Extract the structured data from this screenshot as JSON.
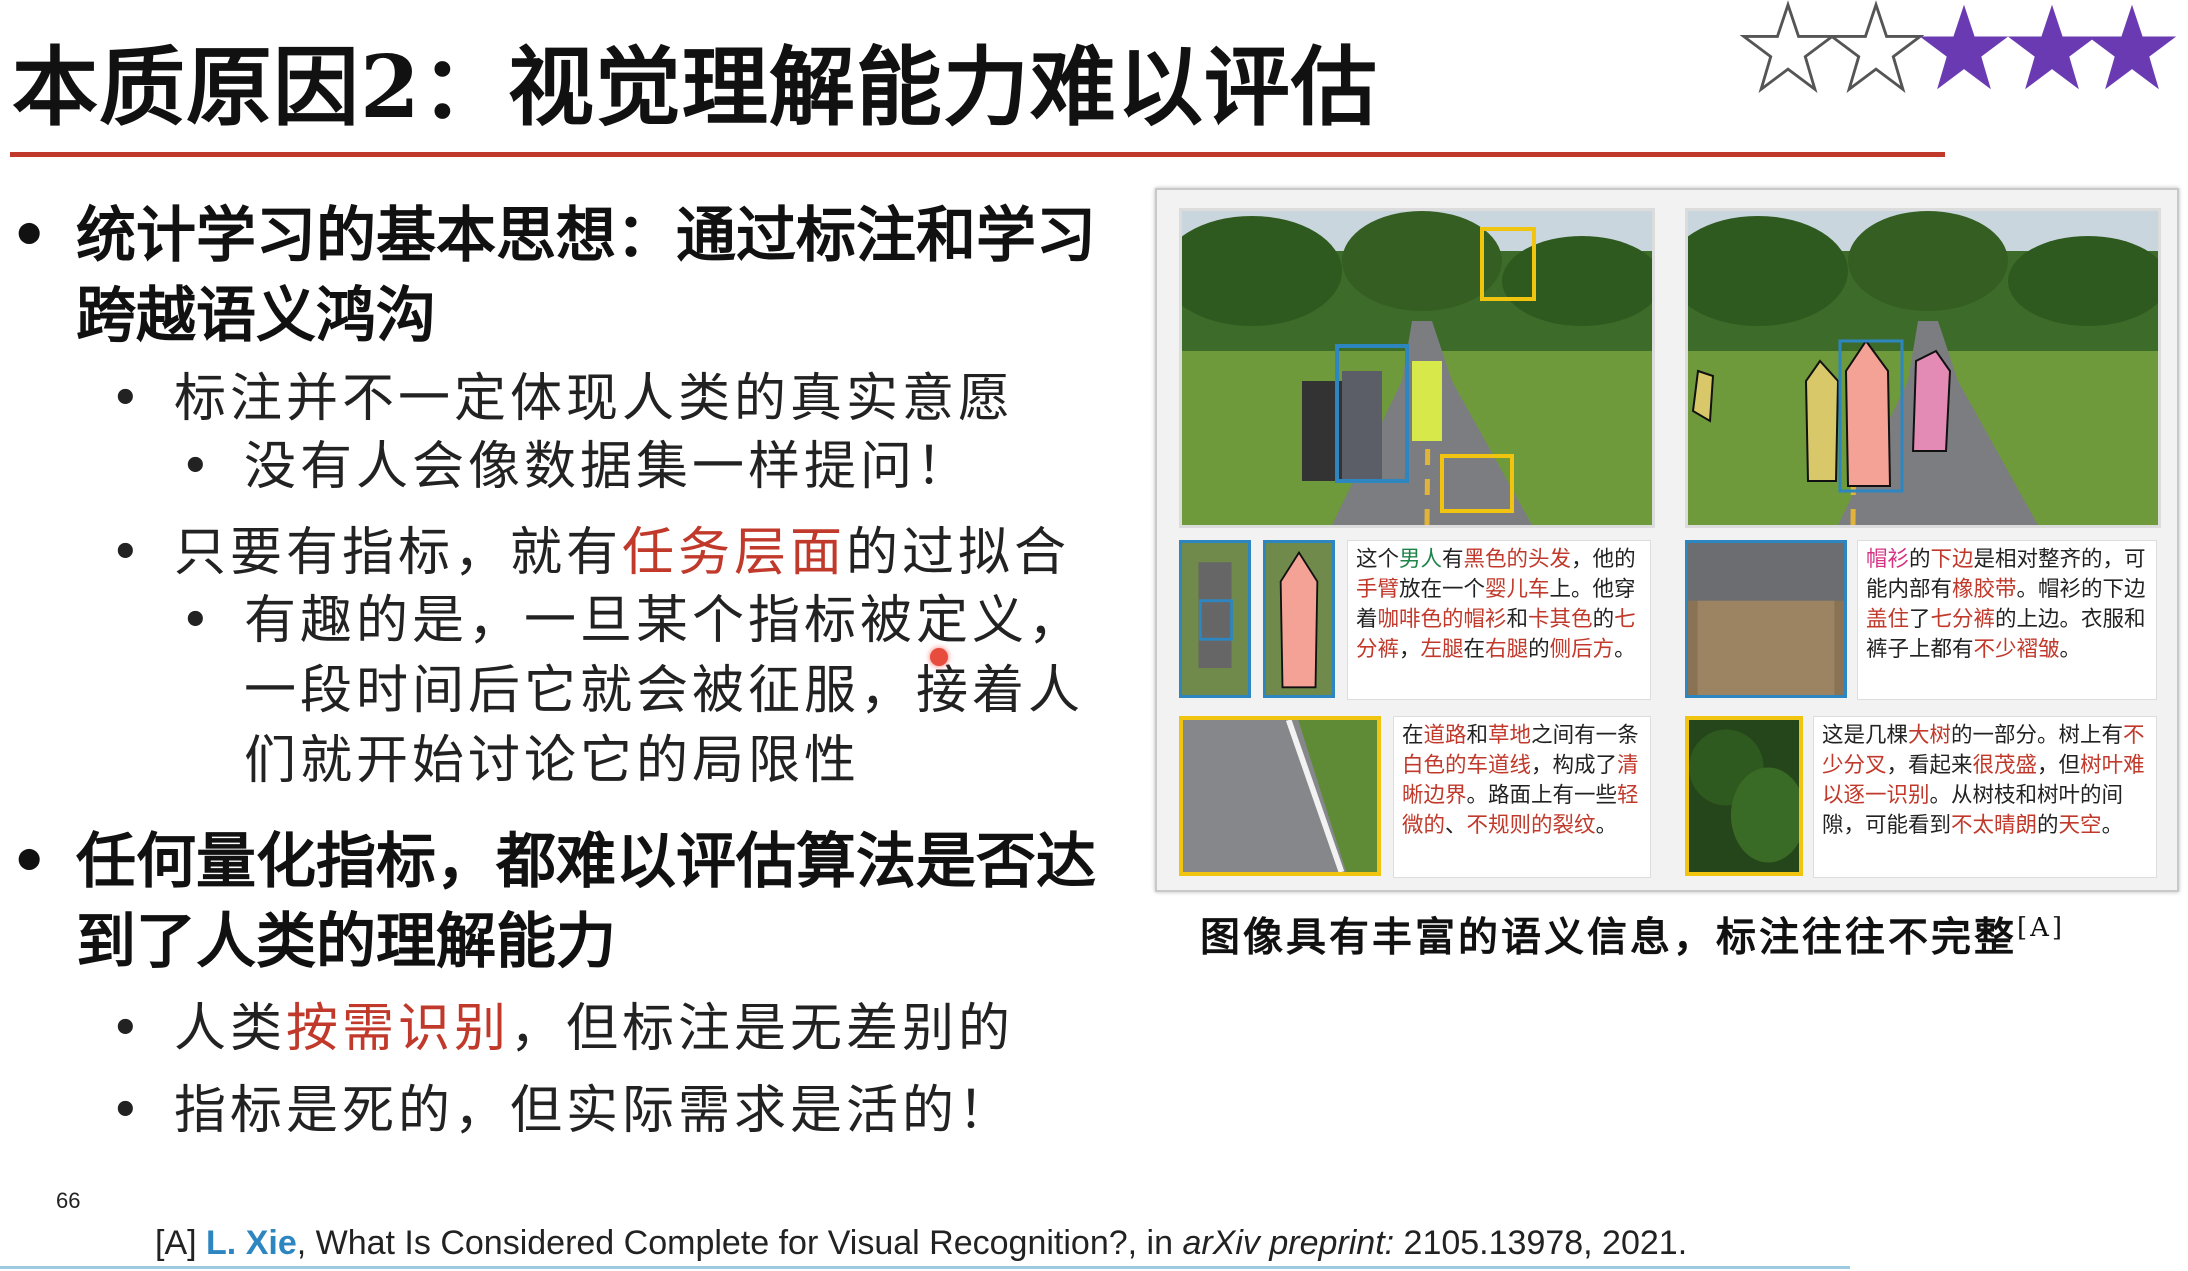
{
  "slide": {
    "title": "本质原因2：视觉理解能力难以评估",
    "rating": {
      "filled": 3,
      "total": 5,
      "accent": "#6a3ab2"
    },
    "page_number": "66"
  },
  "bullets": {
    "b1": {
      "dot": "•",
      "text": "统计学习的基本思想：通过标注和学习跨越语义鸿沟"
    },
    "b1_1": {
      "dot": "•",
      "text": "标注并不一定体现人类的真实意愿"
    },
    "b1_1_1": {
      "dot": "•",
      "text": "没有人会像数据集一样提问！"
    },
    "b1_2": {
      "dot": "•",
      "pre": "只要有指标，就有",
      "red": "任务层面",
      "post": "的过拟合"
    },
    "b1_2_1": {
      "dot": "•",
      "text": "有趣的是，一旦某个指标被定义，一段时间后它就会被征服，接着人们就开始讨论它的局限性"
    },
    "b2": {
      "dot": "•",
      "text": "任何量化指标，都难以评估算法是否达到了人类的理解能力"
    },
    "b2_1": {
      "dot": "•",
      "pre": "人类",
      "red": "按需识别",
      "post": "，但标注是无差别的"
    },
    "b2_2": {
      "dot": "•",
      "text": "指标是死的，但实际需求是活的！"
    }
  },
  "figure": {
    "caption": "图像具有丰富的语义信息，标注往往不完整",
    "caption_ref": "[A]",
    "panel1": {
      "p1": "这个",
      "g1": "男人",
      "p2": "有",
      "r1": "黑色的头发",
      "p3": "，他的",
      "r2": "手臂",
      "p4": "放在一个",
      "r3": "婴儿车",
      "p5": "上。他穿着",
      "r4": "咖啡色的帽衫",
      "p6": "和",
      "r5": "卡其色",
      "p7": "的",
      "r6": "七分裤",
      "p8": "，",
      "r7": "左腿",
      "p9": "在",
      "r8": "右腿",
      "p10": "的",
      "r9": "侧后方",
      "p11": "。"
    },
    "panel2": {
      "r1": "帽衫",
      "p1": "的",
      "r2": "下边",
      "p2": "是相对整齐的，可能内部有",
      "r3": "橡胶带",
      "p3": "。帽衫的下边",
      "r4": "盖住",
      "p4": "了",
      "r5": "七分裤",
      "p5": "的上边。衣服和裤子上都有",
      "r6": "不少褶皱",
      "p6": "。"
    },
    "panel3": {
      "p1": "在",
      "r1": "道路",
      "p2": "和",
      "r2": "草地",
      "p3": "之间有一条",
      "r3": "白色的车道线",
      "p4": "，构成了",
      "r4": "清晰边界",
      "p5": "。路面上有一些",
      "r5": "轻微的",
      "p6": "、",
      "r6": "不规则的",
      "p7": "",
      "r7": "裂纹",
      "p8": "。"
    },
    "panel4": {
      "p1": "这是几棵",
      "r1": "大树",
      "p2": "的一部分。树上有",
      "r2": "不少分叉",
      "p3": "，看起来",
      "r3": "很茂盛",
      "p4": "，但",
      "r4": "树叶",
      "p5": "",
      "r5": "难以逐一识别",
      "p6": "。从树枝和树叶的间隙，可能看到",
      "r6": "不太晴朗",
      "p7": "的",
      "r7": "天空",
      "p8": "。"
    }
  },
  "reference": {
    "tag": "[A]",
    "author": "L. Xie",
    "title": ", What Is Considered Complete for Visual Recognition?, in ",
    "venue": "arXiv preprint:",
    "rest": " 2105.13978, 2021."
  }
}
